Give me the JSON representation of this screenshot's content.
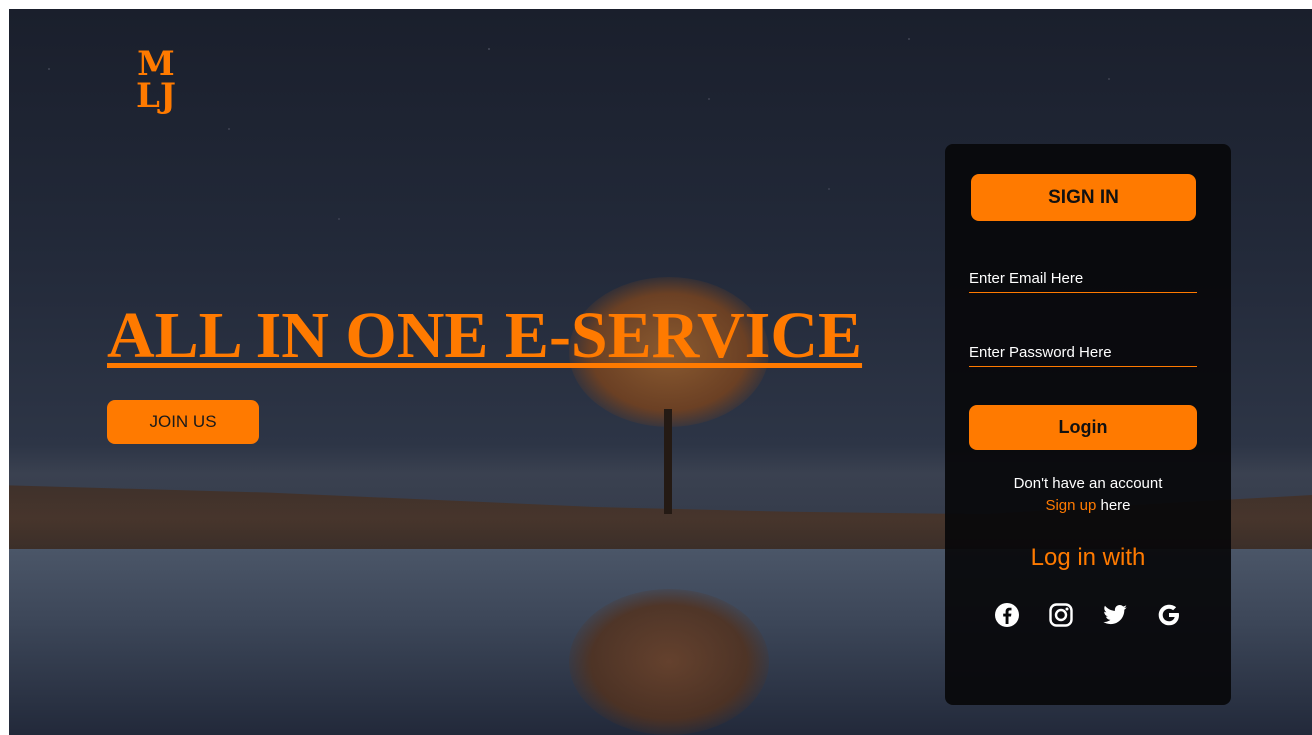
{
  "logo": {
    "line1": "M",
    "line2": "LJ"
  },
  "hero": {
    "title": "ALL IN ONE E-SERVICE",
    "join_label": "JOIN US"
  },
  "panel": {
    "tab_label": "SIGN IN",
    "email_placeholder": "Enter Email Here",
    "password_placeholder": "Enter Password Here",
    "login_label": "Login",
    "no_account_text": "Don't have an account",
    "signup_link": "Sign up",
    "signup_suffix": " here",
    "login_with": "Log in with",
    "social_icons": [
      "facebook-icon",
      "instagram-icon",
      "twitter-icon",
      "google-icon"
    ]
  },
  "colors": {
    "accent": "#ff7a00",
    "panel_bg": "#08080a",
    "text": "#ffffff"
  }
}
